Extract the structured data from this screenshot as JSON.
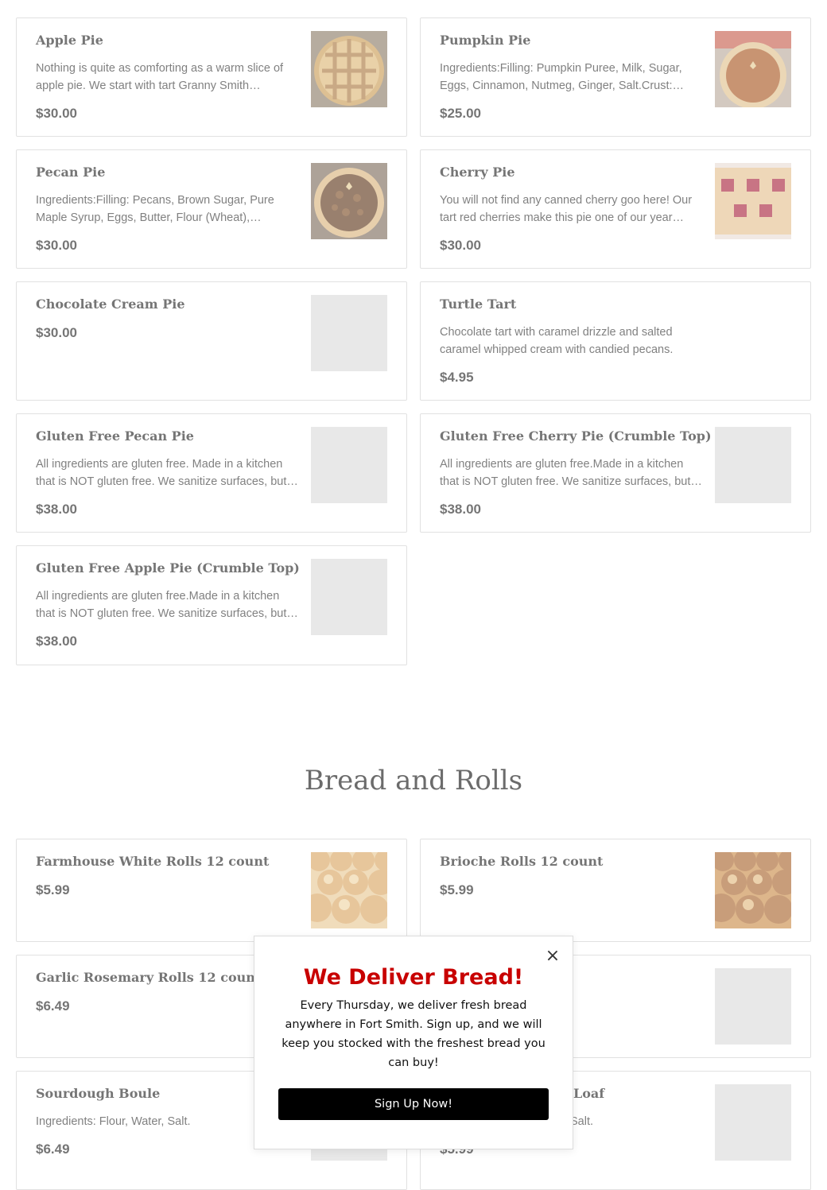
{
  "products_top": [
    {
      "name": "Apple Pie",
      "description": "Nothing is quite as comforting as a warm slice of apple pie. We start with tart Granny Smith apples,…",
      "price": "$30.00",
      "image": "apple-pie"
    },
    {
      "name": "Pumpkin Pie",
      "description": "Ingredients:Filling: Pumpkin Puree, Milk, Sugar, Eggs, Cinnamon, Nutmeg, Ginger, Salt.Crust:…",
      "price": "$25.00",
      "image": "pumpkin-pie"
    },
    {
      "name": "Pecan Pie",
      "description": "Ingredients:Filling: Pecans, Brown Sugar, Pure Maple Syrup, Eggs, Butter, Flour (Wheat),…",
      "price": "$30.00",
      "image": "pecan-pie"
    },
    {
      "name": "Cherry Pie",
      "description": "You will not find any canned cherry goo here! Our tart red cherries make this pie one of our year…",
      "price": "$30.00",
      "image": "cherry-pie"
    },
    {
      "name": "Chocolate Cream Pie",
      "description": "",
      "price": "$30.00",
      "image": "placeholder"
    },
    {
      "name": "Turtle Tart",
      "description": "Chocolate tart with caramel drizzle and salted caramel whipped cream with candied pecans.",
      "price": "$4.95",
      "image": "none"
    },
    {
      "name": "Gluten Free Pecan Pie",
      "description": "All ingredients are gluten free. Made in a kitchen that is NOT gluten free. We sanitize surfaces, but…",
      "price": "$38.00",
      "image": "placeholder"
    },
    {
      "name": "Gluten Free Cherry Pie (Crumble Top)",
      "description": "All ingredients are gluten free.Made in a kitchen that is NOT gluten free. We sanitize surfaces, but…",
      "price": "$38.00",
      "image": "placeholder"
    },
    {
      "name": "Gluten Free Apple Pie (Crumble Top)",
      "description": "All ingredients are gluten free.Made in a kitchen that is NOT gluten free. We sanitize surfaces, but…",
      "price": "$38.00",
      "image": "placeholder"
    }
  ],
  "bread_section": {
    "title": "Bread and Rolls",
    "items": [
      {
        "name": "Farmhouse White Rolls 12 count",
        "description": "",
        "price": "$5.99",
        "image": "rolls"
      },
      {
        "name": "Brioche Rolls 12 count",
        "description": "",
        "price": "$5.99",
        "image": "rolls"
      },
      {
        "name": "Garlic Rosemary Rolls 12 count",
        "description": "",
        "price": "$6.49",
        "image": "none"
      },
      {
        "name": "",
        "description": "",
        "price": "",
        "image": "placeholder"
      },
      {
        "name": "Sourdough Boule",
        "description": "Ingredients: Flour, Water, Salt.",
        "price": "$6.49",
        "image": "placeholder"
      },
      {
        "name": "Loaf",
        "description": "Salt.",
        "price": "$5.99",
        "image": "placeholder"
      }
    ]
  },
  "modal": {
    "close_label": "×",
    "headline": "We Deliver Bread!",
    "body": "Every Thursday, we deliver fresh bread anywhere in Fort Smith.  Sign up, and we will keep you stocked with the freshest bread you can buy!",
    "cta_label": "Sign Up Now!",
    "headline_color": "#c80000"
  }
}
